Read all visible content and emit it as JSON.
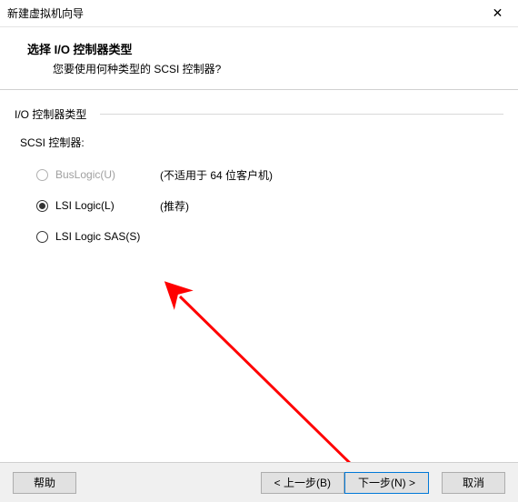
{
  "window": {
    "title": "新建虚拟机向导"
  },
  "header": {
    "heading": "选择 I/O 控制器类型",
    "subheading": "您要使用何种类型的 SCSI 控制器?"
  },
  "group": {
    "label": "I/O 控制器类型",
    "scsi_label": "SCSI 控制器:"
  },
  "options": [
    {
      "label": "BusLogic(U)",
      "hint": "(不适用于 64 位客户机)",
      "disabled": true,
      "selected": false
    },
    {
      "label": "LSI Logic(L)",
      "hint": "(推荐)",
      "disabled": false,
      "selected": true
    },
    {
      "label": "LSI Logic SAS(S)",
      "hint": "",
      "disabled": false,
      "selected": false
    }
  ],
  "buttons": {
    "help": "帮助",
    "back": "< 上一步(B)",
    "next": "下一步(N) >",
    "cancel": "取消"
  }
}
